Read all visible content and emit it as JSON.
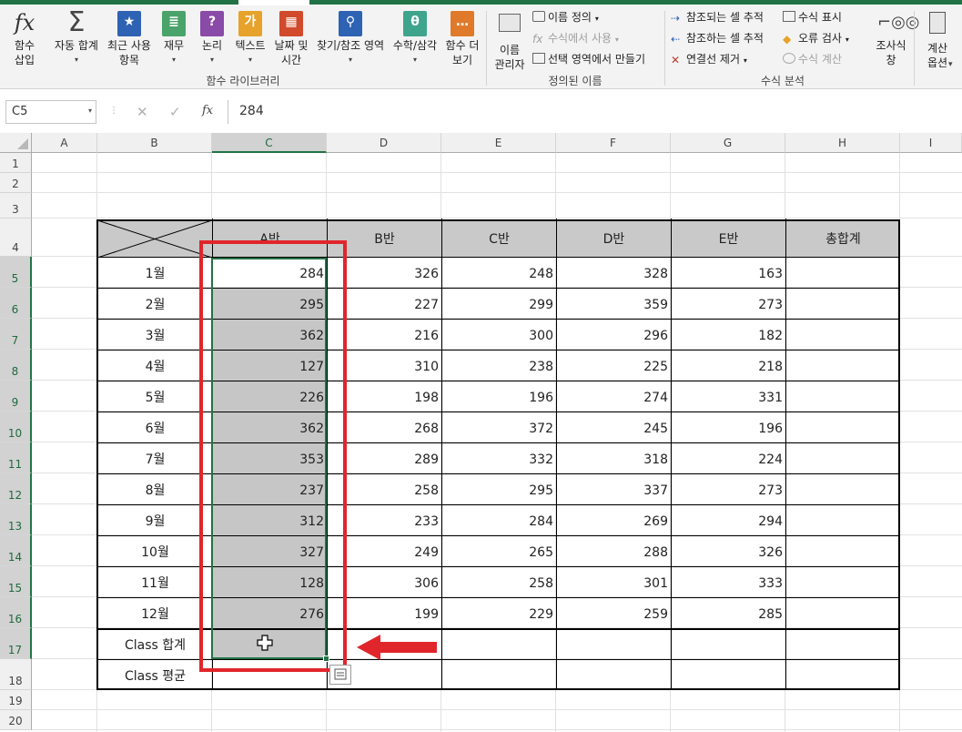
{
  "ribbon": {
    "insert_function": [
      "함수",
      "삽입"
    ],
    "autosum": [
      "자동 합계"
    ],
    "recent": [
      "최근 사용",
      "항목"
    ],
    "financial": [
      "재무"
    ],
    "logical": [
      "논리"
    ],
    "text": [
      "텍스트"
    ],
    "datetime": [
      "날짜 및",
      "시간"
    ],
    "lookup": [
      "찾기/참조 영역"
    ],
    "math": [
      "수학/삼각"
    ],
    "more": [
      "함수 더",
      "보기"
    ],
    "group_library": "함수 라이브러리",
    "name_manager": [
      "이름",
      "관리자"
    ],
    "define_name": "이름 정의",
    "use_in_formula": "수식에서 사용",
    "create_from_selection": "선택 영역에서 만들기",
    "group_names": "정의된 이름",
    "trace_precedents": "참조되는 셀 추적",
    "trace_dependents": "참조하는 셀 추적",
    "remove_arrows": "연결선 제거",
    "show_formulas": "수식 표시",
    "error_checking": "오류 검사",
    "evaluate_formula": "수식 계산",
    "group_auditing": "수식 분석",
    "watch_window": [
      "조사식",
      "창"
    ],
    "calc_options": [
      "계산",
      "옵션"
    ]
  },
  "formula_bar": {
    "name_box": "C5",
    "cancel": "✕",
    "enter": "✓",
    "fx": "fx",
    "formula": "284"
  },
  "columns": [
    "A",
    "B",
    "C",
    "D",
    "E",
    "F",
    "G",
    "H",
    "I"
  ],
  "rows": [
    "1",
    "2",
    "3",
    "4",
    "5",
    "6",
    "7",
    "8",
    "9",
    "10",
    "11",
    "12",
    "13",
    "14",
    "15",
    "16",
    "17",
    "18",
    "19",
    "20"
  ],
  "table": {
    "headers": [
      "A반",
      "B반",
      "C반",
      "D반",
      "E반",
      "총합계"
    ],
    "months": [
      "1월",
      "2월",
      "3월",
      "4월",
      "5월",
      "6월",
      "7월",
      "8월",
      "9월",
      "10월",
      "11월",
      "12월"
    ],
    "values": [
      [
        284,
        326,
        248,
        328,
        163
      ],
      [
        295,
        227,
        299,
        359,
        273
      ],
      [
        362,
        216,
        300,
        296,
        182
      ],
      [
        127,
        310,
        238,
        225,
        218
      ],
      [
        226,
        198,
        196,
        274,
        331
      ],
      [
        362,
        268,
        372,
        245,
        196
      ],
      [
        353,
        289,
        332,
        318,
        224
      ],
      [
        237,
        258,
        295,
        337,
        273
      ],
      [
        312,
        233,
        284,
        269,
        294
      ],
      [
        327,
        249,
        265,
        288,
        326
      ],
      [
        128,
        306,
        258,
        301,
        333
      ],
      [
        276,
        199,
        229,
        259,
        285
      ]
    ],
    "sum_label": "Class 합계",
    "avg_label": "Class 평균"
  },
  "colors": {
    "excel_green": "#217346",
    "annotation_red": "#e0262b",
    "header_fill": "#c9c9c9",
    "selection_fill": "#c6c6c6"
  }
}
